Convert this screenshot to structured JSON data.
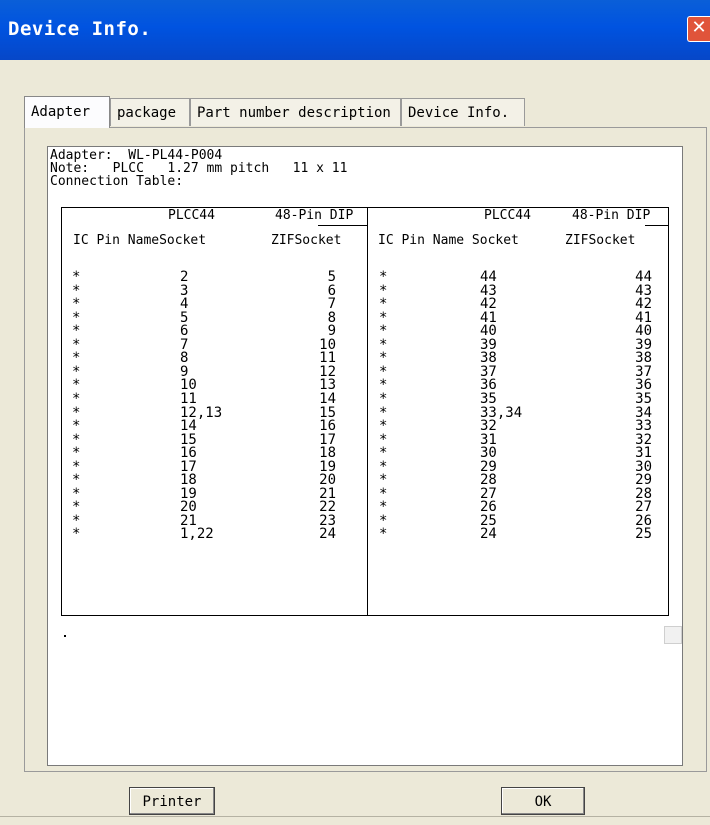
{
  "window": {
    "title": "Device Info."
  },
  "tabs": [
    "Adapter",
    "package",
    "Part number description",
    "Device Info."
  ],
  "info": {
    "adapter": "Adapter:  WL-PL44-P004",
    "note": "Note:   PLCC   1.27 mm pitch   11 x 11",
    "conn": "Connection Table:"
  },
  "table": {
    "left": {
      "header1_a": "PLCC44",
      "header1_b": "48-Pin DIP",
      "header2_a": "IC Pin NameSocket",
      "header2_b": "ZIFSocket",
      "star": [
        "*",
        "*",
        "*",
        "*",
        "*",
        "*",
        "*",
        "*",
        "*",
        "*",
        "*",
        "*",
        "*",
        "*",
        "*",
        "*",
        "*",
        "*",
        "*",
        "*",
        "*"
      ],
      "socket": [
        "2",
        "3",
        "4",
        "5",
        "6",
        "7",
        "8",
        "9",
        "10",
        "11",
        "12,13",
        "14",
        "15",
        "16",
        "17",
        "18",
        "19",
        "20",
        "21",
        "1,22"
      ],
      "zif": [
        "5",
        "6",
        "7",
        "8",
        "9",
        "10",
        "11",
        "12",
        "13",
        "14",
        "15",
        "16",
        "17",
        "18",
        "19",
        "20",
        "21",
        "22",
        "23",
        "24"
      ]
    },
    "right": {
      "header1_a": "PLCC44",
      "header1_b": "48-Pin DIP",
      "header2_a": "IC Pin Name Socket",
      "header2_b": "ZIFSocket",
      "socket": [
        "44",
        "43",
        "42",
        "41",
        "40",
        "39",
        "38",
        "37",
        "36",
        "35",
        "33,34",
        "32",
        "31",
        "30",
        "29",
        "28",
        "27",
        "26",
        "25",
        "24"
      ],
      "zif": [
        "44",
        "43",
        "42",
        "41",
        "40",
        "39",
        "38",
        "37",
        "36",
        "35",
        "34",
        "33",
        "32",
        "31",
        "30",
        "29",
        "28",
        "27",
        "26",
        "25"
      ]
    }
  },
  "buttons": {
    "printer": "Printer",
    "ok": "OK"
  }
}
